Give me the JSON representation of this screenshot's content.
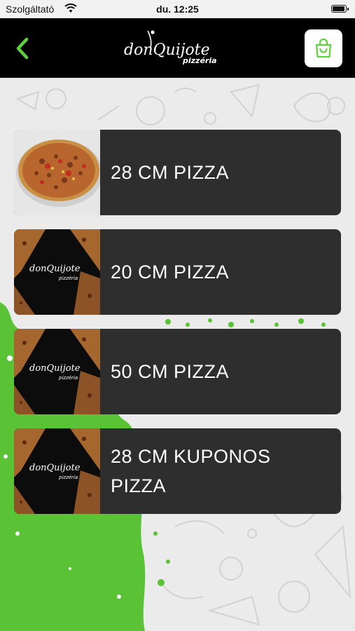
{
  "status_bar": {
    "carrier": "Szolgáltató",
    "time": "du. 12:25"
  },
  "header": {
    "logo_main": "donQuijote",
    "logo_sub": "pizzéria",
    "back_icon": "chevron-left-icon",
    "cart_icon": "shopping-bag-icon",
    "accent_color": "#5fd13b"
  },
  "menu": {
    "items": [
      {
        "label": "28 CM PIZZA",
        "image": "pizza-photo"
      },
      {
        "label": "20 CM PIZZA",
        "image": "logo-pizza-image"
      },
      {
        "label": "50 CM PIZZA",
        "image": "logo-pizza-image"
      },
      {
        "label": "28 CM KUPONOS PIZZA",
        "image": "logo-pizza-image"
      }
    ]
  },
  "thumb_logo": {
    "main": "donQuijote",
    "sub": "pizzéria"
  }
}
